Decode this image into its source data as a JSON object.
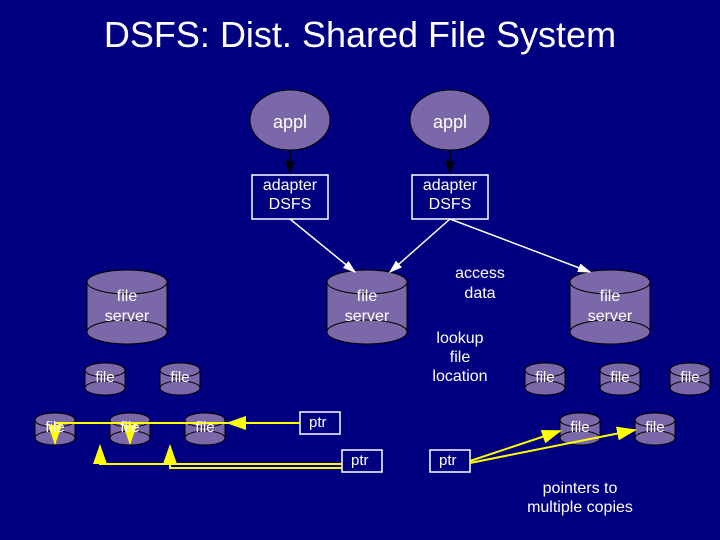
{
  "title": "DSFS: Dist. Shared File System",
  "appl": "appl",
  "adapter_line1": "adapter",
  "adapter_line2": "DSFS",
  "file_server_line1": "file",
  "file_server_line2": "server",
  "access_line1": "access",
  "access_line2": "data",
  "lookup_line1": "lookup",
  "lookup_line2": "file",
  "lookup_line3": "location",
  "file": "file",
  "ptr": "ptr",
  "pointers_line1": "pointers to",
  "pointers_line2": "multiple copies",
  "colors": {
    "bg": "#000080",
    "ellipse_fill": "#7B68A8",
    "outline": "#000000",
    "text": "#ffffff",
    "arrow_yellow": "#ffff00",
    "arrow_white": "#ffffff",
    "arrow_black": "#000000"
  }
}
